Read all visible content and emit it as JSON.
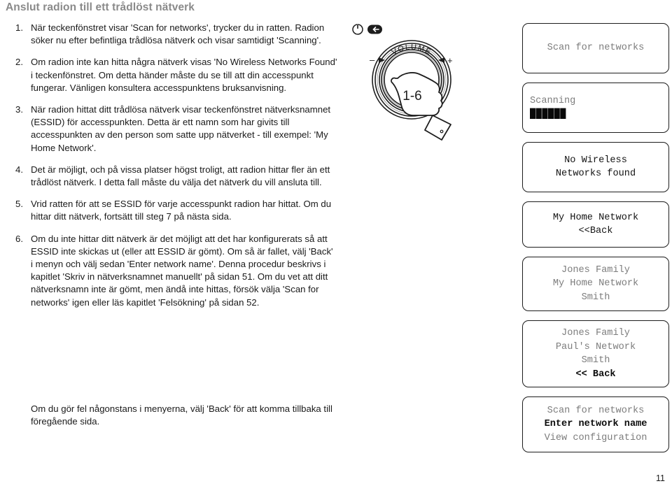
{
  "page": {
    "title": "Anslut radion till ett trådlöst nätverk",
    "number": "11"
  },
  "steps": [
    {
      "number": "1.",
      "text": "När teckenfönstret visar 'Scan for networks', trycker du in ratten. Radion söker nu efter befintliga trådlösa nätverk och visar samtidigt 'Scanning'."
    },
    {
      "number": "2.",
      "text": "Om radion inte kan hitta några nätverk visas 'No Wireless Networks Found' i teckenfönstret. Om detta händer måste du se till att din accesspunkt fungerar. Vänligen konsultera accesspunktens bruksanvisning."
    },
    {
      "number": "3.",
      "text": "När radion hittat ditt trådlösa nätverk visar teckenfönstret nätverksnamnet (ESSID) för accesspunkten. Detta är ett namn som har givits till accesspunkten av den person som satte upp nätverket - till exempel: 'My Home Network'."
    },
    {
      "number": "4.",
      "text": "Det är möjligt, och på vissa platser högst troligt, att radion hittar fler än ett trådlöst nätverk. I detta fall måste du välja det nätverk du vill ansluta till."
    },
    {
      "number": "5.",
      "text": "Vrid ratten för att se ESSID för varje accesspunkt radion har hittat. Om du hittar ditt nätverk, fortsätt till steg 7 på nästa sida."
    },
    {
      "number": "6.",
      "text": "Om du inte hittar ditt nätverk är det möjligt att det har konfigurerats så att ESSID inte skickas ut (eller att ESSID är gömt). Om så är fallet, välj 'Back' i menyn och välj sedan 'Enter network name'. Denna procedur beskrivs i kapitlet 'Skriv in nätverksnamnet manuellt' på sidan 51. Om du vet att ditt nätverksnamn inte är gömt, men ändå inte hittas, försök välja 'Scan for networks' igen eller läs kapitlet 'Felsökning' på sidan 52."
    }
  ],
  "closing_note": "Om du gör fel någonstans i menyerna, välj 'Back' för att komma tillbaka till föregående sida.",
  "illustration": {
    "knob_label": "VOLUME",
    "minus_label": "−",
    "plus_label": "+",
    "hand_label": "1-6",
    "power_icon": "power-icon",
    "back_icon": "back-icon"
  },
  "displays": [
    {
      "name": "display-scan-for-networks",
      "align": "center",
      "lines": [
        {
          "text": "Scan for networks",
          "style": "normal"
        }
      ]
    },
    {
      "name": "display-scanning",
      "align": "left",
      "lines": [
        {
          "text": "Scanning",
          "style": "normal"
        },
        {
          "text": "██████",
          "style": "blocks"
        }
      ]
    },
    {
      "name": "display-no-wireless-networks",
      "align": "center",
      "lines": [
        {
          "text": "No Wireless",
          "style": "dark"
        },
        {
          "text": "Networks found",
          "style": "dark"
        }
      ]
    },
    {
      "name": "display-my-home-network",
      "align": "center",
      "lines": [
        {
          "text": "My Home Network",
          "style": "dark"
        },
        {
          "text": "<<Back",
          "style": "dark"
        }
      ]
    },
    {
      "name": "display-network-list",
      "align": "center",
      "lines": [
        {
          "text": "Jones Family",
          "style": "normal"
        },
        {
          "text": "My Home Network",
          "style": "normal"
        },
        {
          "text": "Smith",
          "style": "normal"
        }
      ]
    },
    {
      "name": "display-network-list-back",
      "align": "center",
      "lines": [
        {
          "text": "Jones Family",
          "style": "normal"
        },
        {
          "text": "Paul's Network",
          "style": "normal"
        },
        {
          "text": "Smith",
          "style": "normal"
        },
        {
          "text": "<< Back",
          "style": "bold"
        }
      ]
    },
    {
      "name": "display-menu-enter-network-name",
      "align": "center",
      "lines": [
        {
          "text": "Scan for networks",
          "style": "normal"
        },
        {
          "text": "Enter network name",
          "style": "bold"
        },
        {
          "text": "View configuration",
          "style": "normal"
        }
      ]
    }
  ]
}
